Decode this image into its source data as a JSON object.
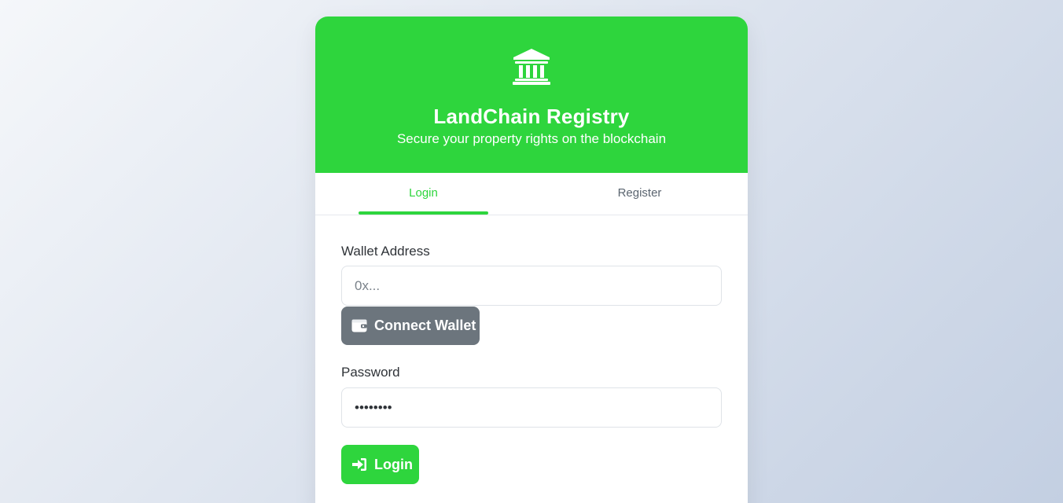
{
  "header": {
    "icon": "bank-building-icon",
    "title": "LandChain Registry",
    "subtitle": "Secure your property rights on the blockchain"
  },
  "tabs": [
    {
      "label": "Login",
      "active": true
    },
    {
      "label": "Register",
      "active": false
    }
  ],
  "form": {
    "wallet_label": "Wallet Address",
    "wallet_placeholder": "0x...",
    "wallet_value": "",
    "connect_button_label": "Connect Wallet",
    "connect_button_icon": "wallet-icon",
    "password_label": "Password",
    "password_value": "••••••••",
    "login_button_label": "Login",
    "login_button_icon": "sign-in-icon"
  },
  "colors": {
    "accent": "#2ed53d",
    "secondary_button": "#6c757d",
    "text": "#2f3338",
    "muted_text": "#5b6570"
  }
}
